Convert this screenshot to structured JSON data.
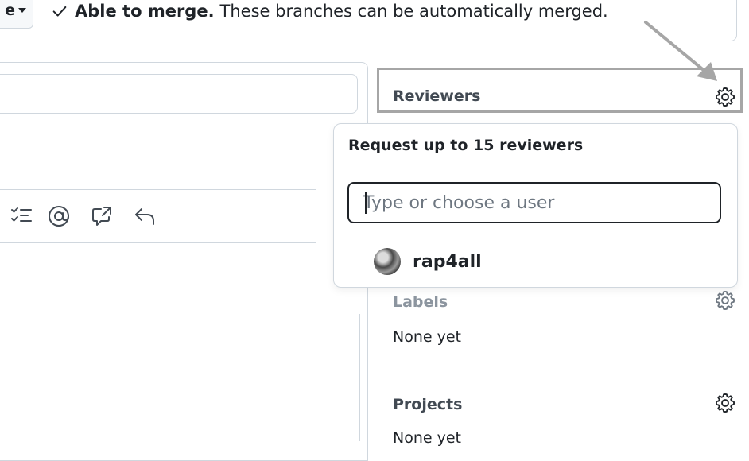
{
  "merge": {
    "split_button_label": "e",
    "status_bold": "Able to merge.",
    "status_text": "These branches can be automatically merged."
  },
  "sidebar": {
    "reviewers": {
      "heading": "Reviewers"
    },
    "labels": {
      "heading": "Labels",
      "value": "None yet"
    },
    "projects": {
      "heading": "Projects",
      "value": "None yet"
    }
  },
  "reviewer_popover": {
    "title": "Request up to 15 reviewers",
    "input_placeholder": "Type or choose a user",
    "users": [
      {
        "name": "rap4all"
      }
    ]
  },
  "toolbar": {
    "icons": [
      "task-list-icon",
      "mention-icon",
      "cross-reference-icon",
      "reply-icon"
    ]
  }
}
